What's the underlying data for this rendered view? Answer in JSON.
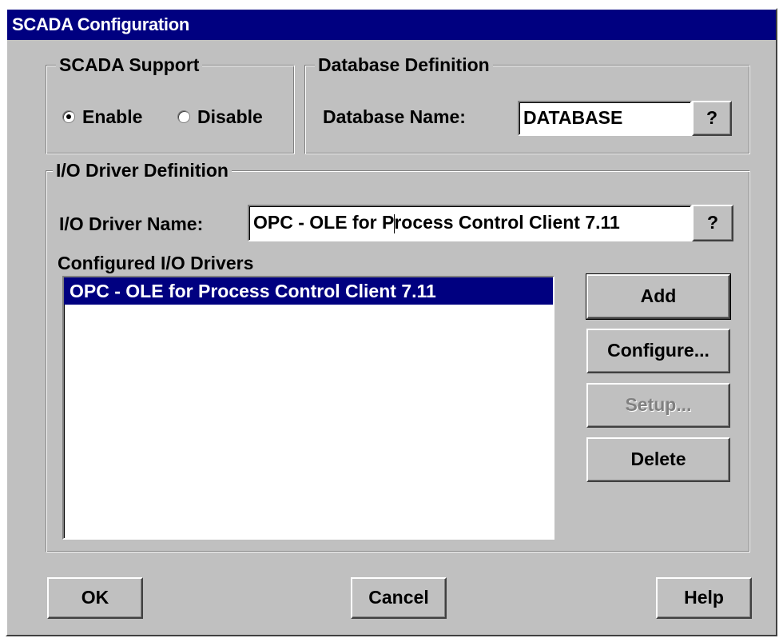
{
  "window": {
    "title": "SCADA Configuration"
  },
  "scada_support": {
    "legend": "SCADA Support",
    "enable_label": "Enable",
    "disable_label": "Disable",
    "selected": "Enable"
  },
  "database_definition": {
    "legend": "Database Definition",
    "name_label": "Database Name:",
    "name_value": "DATABASE",
    "help_label": "?"
  },
  "io_driver_definition": {
    "legend": "I/O Driver Definition",
    "name_label": "I/O Driver Name:",
    "name_value_before_caret": "OPC - OLE for P",
    "name_value_after_caret": "rocess Control Client  7.11",
    "help_label": "?",
    "configured_label": "Configured I/O Drivers",
    "configured_drivers": [
      {
        "label": "OPC - OLE for Process Control Client  7.11",
        "selected": true
      }
    ],
    "add_label": "Add",
    "configure_label": "Configure...",
    "setup_label": "Setup...",
    "delete_label": "Delete"
  },
  "footer": {
    "ok_label": "OK",
    "cancel_label": "Cancel",
    "help_label": "Help"
  },
  "colors": {
    "titlebar": "#000080",
    "face": "#c0c0c0",
    "selection": "#000080"
  }
}
